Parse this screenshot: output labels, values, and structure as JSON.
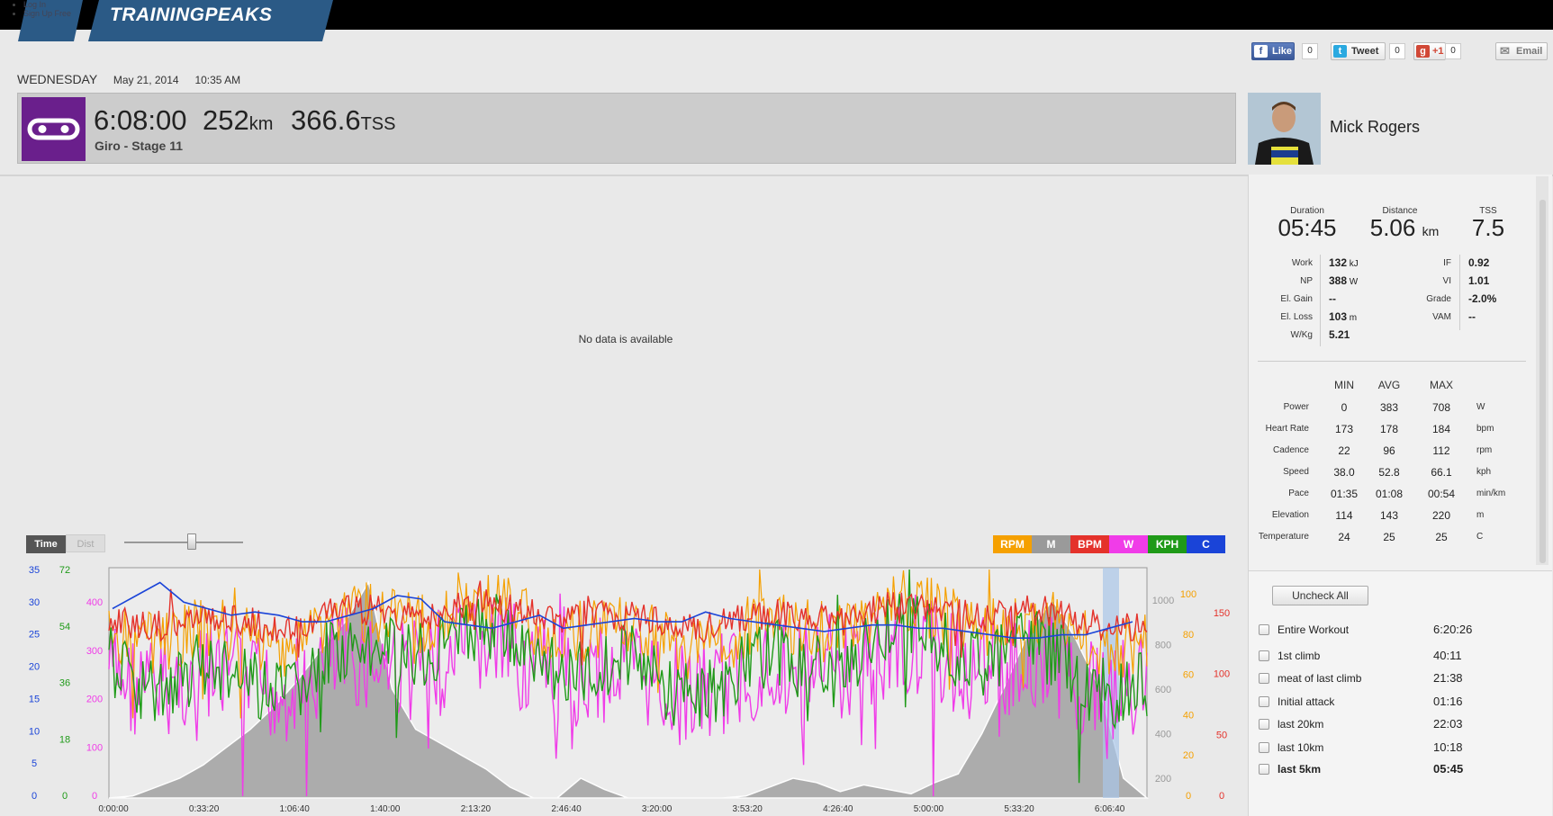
{
  "nav": {
    "login_link": "Log In",
    "signup_link": "Sign Up Free",
    "logo": "TRAININGPEAKS"
  },
  "social": {
    "like_label": "Like",
    "like_count": "0",
    "tweet_label": "Tweet",
    "tweet_count": "0",
    "gplus_label": "+1",
    "gplus_count": "0",
    "email_label": "Email"
  },
  "workout": {
    "day": "Wednesday",
    "date": "May 21, 2014",
    "time": "10:35 AM",
    "duration": "6:08:00",
    "distance_value": "252",
    "distance_unit": "km",
    "tss_value": "366.6",
    "tss_unit": "TSS",
    "title": "Giro - Stage 11",
    "sport_color": "#6a1f8c"
  },
  "athlete": {
    "name": "Mick Rogers"
  },
  "graph": {
    "no_data": "No data is available",
    "toggle_time": "Time",
    "toggle_dist": "Dist",
    "legend": [
      {
        "label": "RPM",
        "color": "#f5a000"
      },
      {
        "label": "M",
        "color": "#9a9a9a"
      },
      {
        "label": "BPM",
        "color": "#e4322b"
      },
      {
        "label": "W",
        "color": "#f03ce8"
      },
      {
        "label": "KPH",
        "color": "#1f9a18"
      },
      {
        "label": "C",
        "color": "#1a44d8"
      }
    ]
  },
  "stats": {
    "duration_label": "Duration",
    "duration": "05:45",
    "distance_label": "Distance",
    "distance": "5.06",
    "distance_unit": "km",
    "tss_label": "TSS",
    "tss": "7.5",
    "left": [
      {
        "label": "Work",
        "value": "132",
        "unit": "kJ"
      },
      {
        "label": "NP",
        "value": "388",
        "unit": "W"
      },
      {
        "label": "El. Gain",
        "value": "--",
        "unit": ""
      },
      {
        "label": "El. Loss",
        "value": "103",
        "unit": "m"
      },
      {
        "label": "W/Kg",
        "value": "5.21",
        "unit": ""
      }
    ],
    "right": [
      {
        "label": "IF",
        "value": "0.92"
      },
      {
        "label": "VI",
        "value": "1.01"
      },
      {
        "label": "Grade",
        "value": "-2.0%"
      },
      {
        "label": "VAM",
        "value": "--"
      }
    ],
    "table_headers": [
      "MIN",
      "AVG",
      "MAX"
    ],
    "table": [
      {
        "label": "Power",
        "min": "0",
        "avg": "383",
        "max": "708",
        "unit": "W"
      },
      {
        "label": "Heart Rate",
        "min": "173",
        "avg": "178",
        "max": "184",
        "unit": "bpm"
      },
      {
        "label": "Cadence",
        "min": "22",
        "avg": "96",
        "max": "112",
        "unit": "rpm"
      },
      {
        "label": "Speed",
        "min": "38.0",
        "avg": "52.8",
        "max": "66.1",
        "unit": "kph"
      },
      {
        "label": "Pace",
        "min": "01:35",
        "avg": "01:08",
        "max": "00:54",
        "unit": "min/km"
      },
      {
        "label": "Elevation",
        "min": "114",
        "avg": "143",
        "max": "220",
        "unit": "m"
      },
      {
        "label": "Temperature",
        "min": "24",
        "avg": "25",
        "max": "25",
        "unit": "C"
      }
    ]
  },
  "laps": {
    "uncheck_all": "Uncheck All",
    "items": [
      {
        "name": "Entire Workout",
        "time": "6:20:26",
        "bold": false
      },
      {
        "name": "1st climb",
        "time": "40:11",
        "bold": false
      },
      {
        "name": "meat of last climb",
        "time": "21:38",
        "bold": false
      },
      {
        "name": "Initial attack",
        "time": "01:16",
        "bold": false
      },
      {
        "name": "last 20km",
        "time": "22:03",
        "bold": false
      },
      {
        "name": "last 10km",
        "time": "10:18",
        "bold": false
      },
      {
        "name": "last 5km",
        "time": "05:45",
        "bold": true
      }
    ]
  },
  "chart_data": {
    "type": "line",
    "x_ticks": [
      "0:00:00",
      "0:33:20",
      "1:06:40",
      "1:40:00",
      "2:13:20",
      "2:46:40",
      "3:20:00",
      "3:53:20",
      "4:26:40",
      "5:00:00",
      "5:33:20",
      "6:06:40"
    ],
    "left_axes": [
      {
        "series": "C",
        "ticks": [
          "35",
          "30",
          "25",
          "20",
          "15",
          "10",
          "5",
          "0"
        ]
      },
      {
        "series": "KPH",
        "ticks": [
          "72",
          "54",
          "36",
          "18",
          "0"
        ]
      },
      {
        "series": "W",
        "ticks": [
          "400",
          "300",
          "200",
          "100",
          "0"
        ]
      }
    ],
    "right_axes": [
      {
        "series": "M",
        "ticks": [
          "1000",
          "800",
          "600",
          "400",
          "200"
        ]
      },
      {
        "series": "RPM",
        "ticks": [
          "100",
          "80",
          "60",
          "40",
          "20",
          "0"
        ]
      },
      {
        "series": "BPM",
        "ticks": [
          "150",
          "100",
          "50",
          "0"
        ]
      }
    ],
    "elevation_profile": [
      80,
      120,
      160,
      200,
      260,
      340,
      420,
      520,
      640,
      780,
      900,
      1080,
      600,
      420,
      360,
      300,
      240,
      160,
      90,
      60,
      200,
      150,
      100,
      60,
      40,
      80,
      70,
      120,
      160,
      200,
      180,
      140,
      170,
      150,
      130,
      180,
      220,
      400,
      620,
      860,
      1000,
      820,
      600,
      200,
      100
    ],
    "temperature_approx": [
      29,
      31,
      33,
      30,
      29,
      28,
      28.5,
      28,
      27,
      27,
      28,
      29,
      31,
      30.5,
      27,
      26.5,
      26,
      27,
      28,
      26,
      26.5,
      27,
      27.5,
      27,
      27,
      28.5,
      27.5,
      27,
      26.5,
      26,
      25.5,
      26,
      26.5,
      26.5,
      26,
      26,
      25.5,
      25,
      24.5,
      24.5,
      25,
      25,
      26,
      27
    ]
  }
}
